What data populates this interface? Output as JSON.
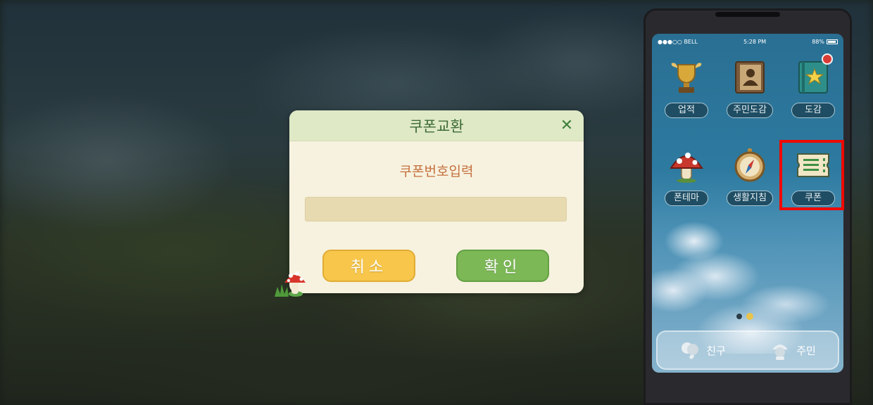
{
  "dialog": {
    "title": "쿠폰교환",
    "prompt": "쿠폰번호입력",
    "input_value": "",
    "cancel_label": "취소",
    "confirm_label": "확인"
  },
  "phone": {
    "status": {
      "carrier": "●●●○○ BELL",
      "time": "5:28 PM",
      "battery": "88%"
    },
    "apps": [
      {
        "label": "업적",
        "icon": "trophy-icon"
      },
      {
        "label": "주민도감",
        "icon": "resident-book-icon"
      },
      {
        "label": "도감",
        "icon": "star-book-icon",
        "badge": true
      },
      {
        "label": "폰테마",
        "icon": "mushroom-icon"
      },
      {
        "label": "생활지침",
        "icon": "compass-icon"
      },
      {
        "label": "쿠폰",
        "icon": "coupon-icon"
      }
    ],
    "dock": [
      {
        "label": "친구",
        "icon": "friends-icon"
      },
      {
        "label": "주민",
        "icon": "resident-icon"
      }
    ]
  },
  "colors": {
    "highlight": "#f00900",
    "cancel_button": "#f7c64a",
    "confirm_button": "#7db857",
    "dialog_title": "#3d6b36",
    "prompt": "#c5703f"
  }
}
